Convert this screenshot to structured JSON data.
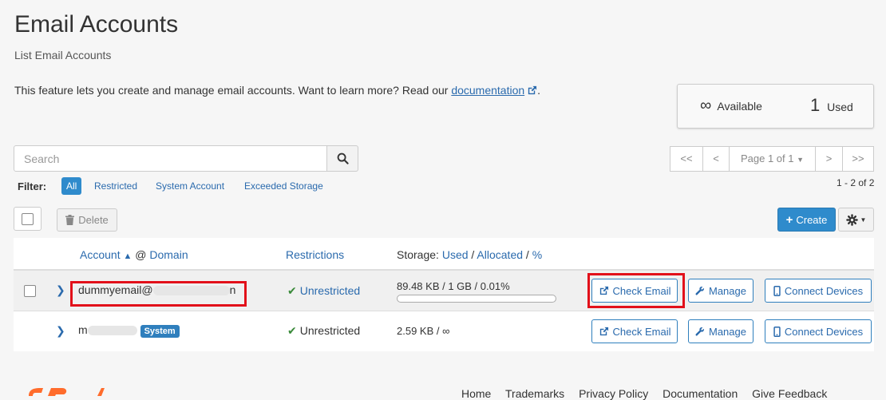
{
  "page": {
    "title": "Email Accounts",
    "subtitle": "List Email Accounts",
    "intro_text": "This feature lets you create and manage email accounts. Want to learn more? Read our ",
    "intro_link": "documentation",
    "intro_end": "."
  },
  "stats": {
    "available_value": "∞",
    "available_label": "Available",
    "used_value": "1",
    "used_label": "Used"
  },
  "search": {
    "placeholder": "Search"
  },
  "filter": {
    "label": "Filter:",
    "options": [
      "All",
      "Restricted",
      "System Account",
      "Exceeded Storage"
    ],
    "selected": "All"
  },
  "pagination": {
    "first": "<<",
    "prev": "<",
    "page_label": "Page 1 of 1",
    "next": ">",
    "last": ">>",
    "count": "1 - 2 of 2"
  },
  "toolbar": {
    "delete_label": "Delete",
    "create_label": "Create"
  },
  "table": {
    "headers": {
      "account": "Account",
      "at": "@",
      "domain": "Domain",
      "restrictions": "Restrictions",
      "storage_prefix": "Storage:",
      "used": "Used",
      "slash": "/",
      "allocated": "Allocated",
      "percent": "%"
    },
    "rows": [
      {
        "account": "dummyemail@",
        "account_end": "n",
        "restriction": "Unrestricted",
        "storage": "89.48 KB / 1 GB / 0.01%",
        "storage_fraction": 0.0001,
        "check_email": "Check Email",
        "manage": "Manage",
        "connect": "Connect Devices"
      },
      {
        "account": "m",
        "badge": "System",
        "restriction": "Unrestricted",
        "storage": "2.59 KB / ∞",
        "check_email": "Check Email",
        "manage": "Manage",
        "connect": "Connect Devices"
      }
    ]
  },
  "footer": {
    "links": [
      "Home",
      "Trademarks",
      "Privacy Policy",
      "Documentation",
      "Give Feedback"
    ]
  },
  "colors": {
    "accent": "#2f8bcc",
    "link": "#2a6aad",
    "highlight": "#e2101a",
    "success": "#3a8a3a"
  }
}
